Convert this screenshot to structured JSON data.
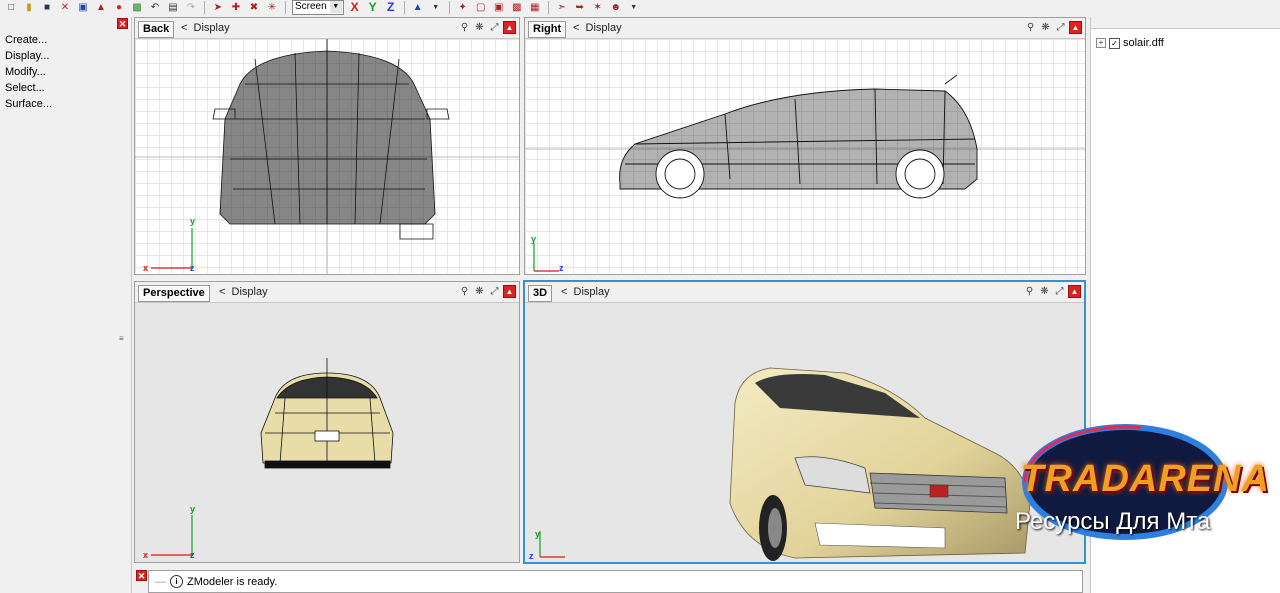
{
  "toolbar": {
    "view_mode": "Screen",
    "axes": [
      "X",
      "Y",
      "Z"
    ],
    "axis_colors": {
      "x": "#d21a1a",
      "y": "#15a020",
      "z": "#1a3fd2"
    }
  },
  "left_panel": {
    "items": [
      "Create...",
      "Display...",
      "Modify...",
      "Select...",
      "Surface..."
    ]
  },
  "viewports": {
    "back": {
      "name": "Back",
      "display": "Display",
      "axes": [
        "x",
        "y",
        "z"
      ]
    },
    "right": {
      "name": "Right",
      "display": "Display",
      "axes": [
        "y",
        "z"
      ]
    },
    "perspective": {
      "name": "Perspective",
      "display": "Display",
      "axes": [
        "x",
        "y",
        "z"
      ]
    },
    "threed": {
      "name": "3D",
      "display": "Display",
      "axes": [
        "y",
        "z"
      ]
    }
  },
  "right_panel": {
    "tree_item": "solair.dff",
    "checked": "✓"
  },
  "status": {
    "message": "ZModeler is ready."
  },
  "watermark": {
    "brand": "TRADARENA",
    "subtitle": "Ресурсы Для Мта"
  },
  "colors": {
    "active_viewport": "#3a8fd0",
    "car_body": "#e8dca8"
  }
}
